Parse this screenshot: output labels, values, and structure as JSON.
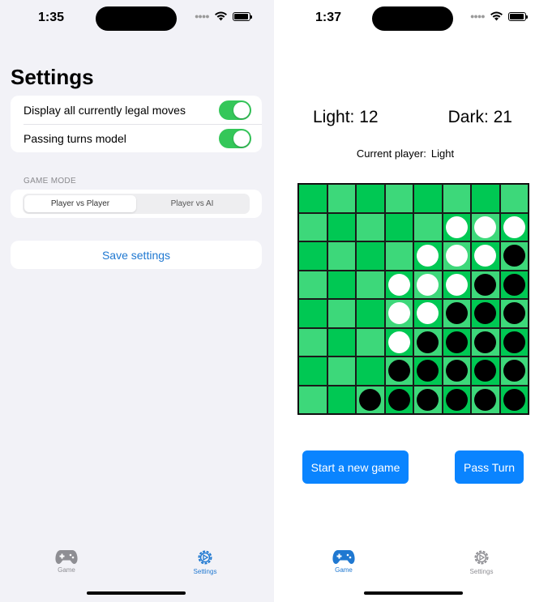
{
  "settings_screen": {
    "status_time": "1:35",
    "title": "Settings",
    "toggles": [
      {
        "label": "Display all currently legal moves",
        "on": true
      },
      {
        "label": "Passing turns model",
        "on": true
      }
    ],
    "game_mode": {
      "header": "GAME MODE",
      "options": [
        "Player vs Player",
        "Player vs AI"
      ],
      "selected": "Player vs Player"
    },
    "save_label": "Save settings",
    "tabs": [
      {
        "label": "Game",
        "icon": "gamecontroller-icon",
        "active": false
      },
      {
        "label": "Settings",
        "icon": "gear-icon",
        "active": true
      }
    ]
  },
  "game_screen": {
    "status_time": "1:37",
    "score": {
      "light": "Light: 12",
      "dark": "Dark: 21"
    },
    "current_player_label": "Current player:",
    "current_player": "Light",
    "board": [
      "........",
      ".....WWW",
      "....WWWB",
      "...WWWBB",
      "...WWBBB",
      "...WBBBB",
      "...BBBBB",
      "..BBBBBB"
    ],
    "board_pattern": [
      "DLDLDLDL",
      "LDLDLDLD",
      "DLDLDLDL",
      "LDLDLDLD",
      "DLDLDLDL",
      "LDLDLDLD",
      "DLDLDLDL",
      "LDLDLDLD"
    ],
    "buttons": {
      "new_game": "Start a new game",
      "pass": "Pass Turn"
    },
    "tabs": [
      {
        "label": "Game",
        "icon": "gamecontroller-icon",
        "active": true
      },
      {
        "label": "Settings",
        "icon": "gear-icon",
        "active": false
      }
    ]
  },
  "colors": {
    "accent": "#1f78d1",
    "toggle_on": "#34c759",
    "button_blue": "#0a84ff",
    "board_dark": "#00c853",
    "board_light": "#3dd87a",
    "inactive_tab": "#8e8e93",
    "settings_bg": "#f2f2f7"
  }
}
